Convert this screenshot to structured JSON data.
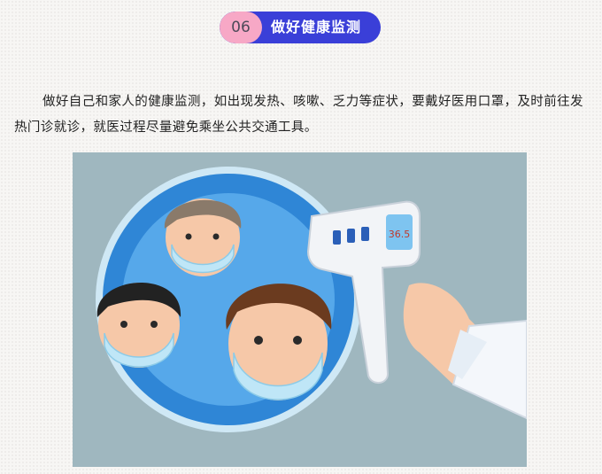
{
  "header": {
    "number": "06",
    "title": "做好健康监测"
  },
  "body": {
    "paragraph": "做好自己和家人的健康监测，如出现发热、咳嗽、乏力等症状，要戴好医用口罩，及时前往发热门诊就诊，就医过程尽量避免乘坐公共交通工具。"
  },
  "illustration": {
    "thermometer_reading": "36.5",
    "colors": {
      "background": "#9fb7bf",
      "circle": "#2f86d6",
      "circle_inner": "#56a8ea",
      "mask": "#bfe6f7",
      "skin": "#f6c8a8",
      "thermometer": "#f2f4f7",
      "screen": "#7ec4f0",
      "buttons": "#2b5fb8"
    }
  }
}
